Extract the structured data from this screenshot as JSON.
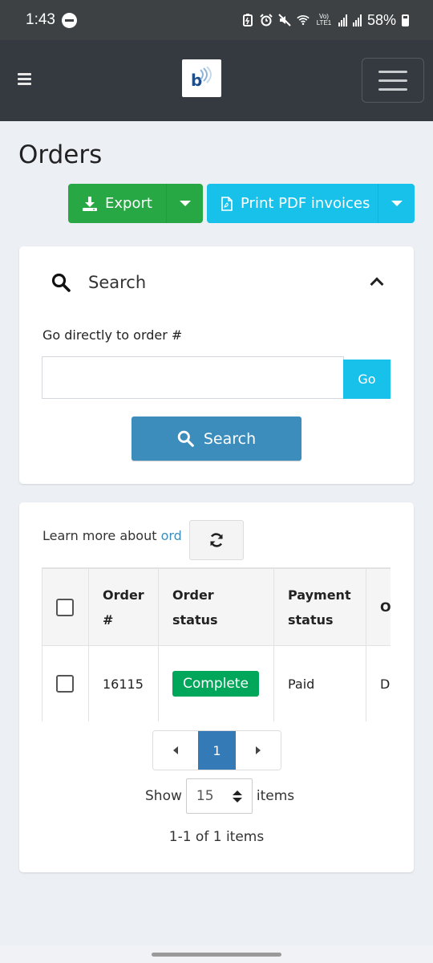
{
  "status_bar": {
    "time": "1:43",
    "network": "Vo) LTE1",
    "battery": "58%"
  },
  "page": {
    "title": "Orders"
  },
  "toolbar": {
    "export_label": "Export",
    "print_label": "Print PDF invoices"
  },
  "search_panel": {
    "title": "Search",
    "goto_label": "Go directly to order #",
    "goto_value": "",
    "go_label": "Go",
    "search_button": "Search"
  },
  "orders_panel": {
    "learn_more_text": "Learn more about ",
    "learn_more_link": "ord",
    "columns": [
      "Order #",
      "Order status",
      "Payment status",
      "O M"
    ],
    "rows": [
      {
        "order_number": "16115",
        "order_status": "Complete",
        "payment_status": "Paid",
        "shipping_method": "Dl"
      }
    ],
    "pager": {
      "current_page": "1"
    },
    "show_label": "Show",
    "page_size": "15",
    "items_label": "items",
    "summary": "1-1 of 1 items"
  },
  "colors": {
    "header": "#343a40",
    "export_green": "#28a745",
    "print_cyan": "#17c1ea",
    "search_blue": "#3c8dbc",
    "complete_badge": "#00a65a",
    "active_page": "#337ab7"
  }
}
